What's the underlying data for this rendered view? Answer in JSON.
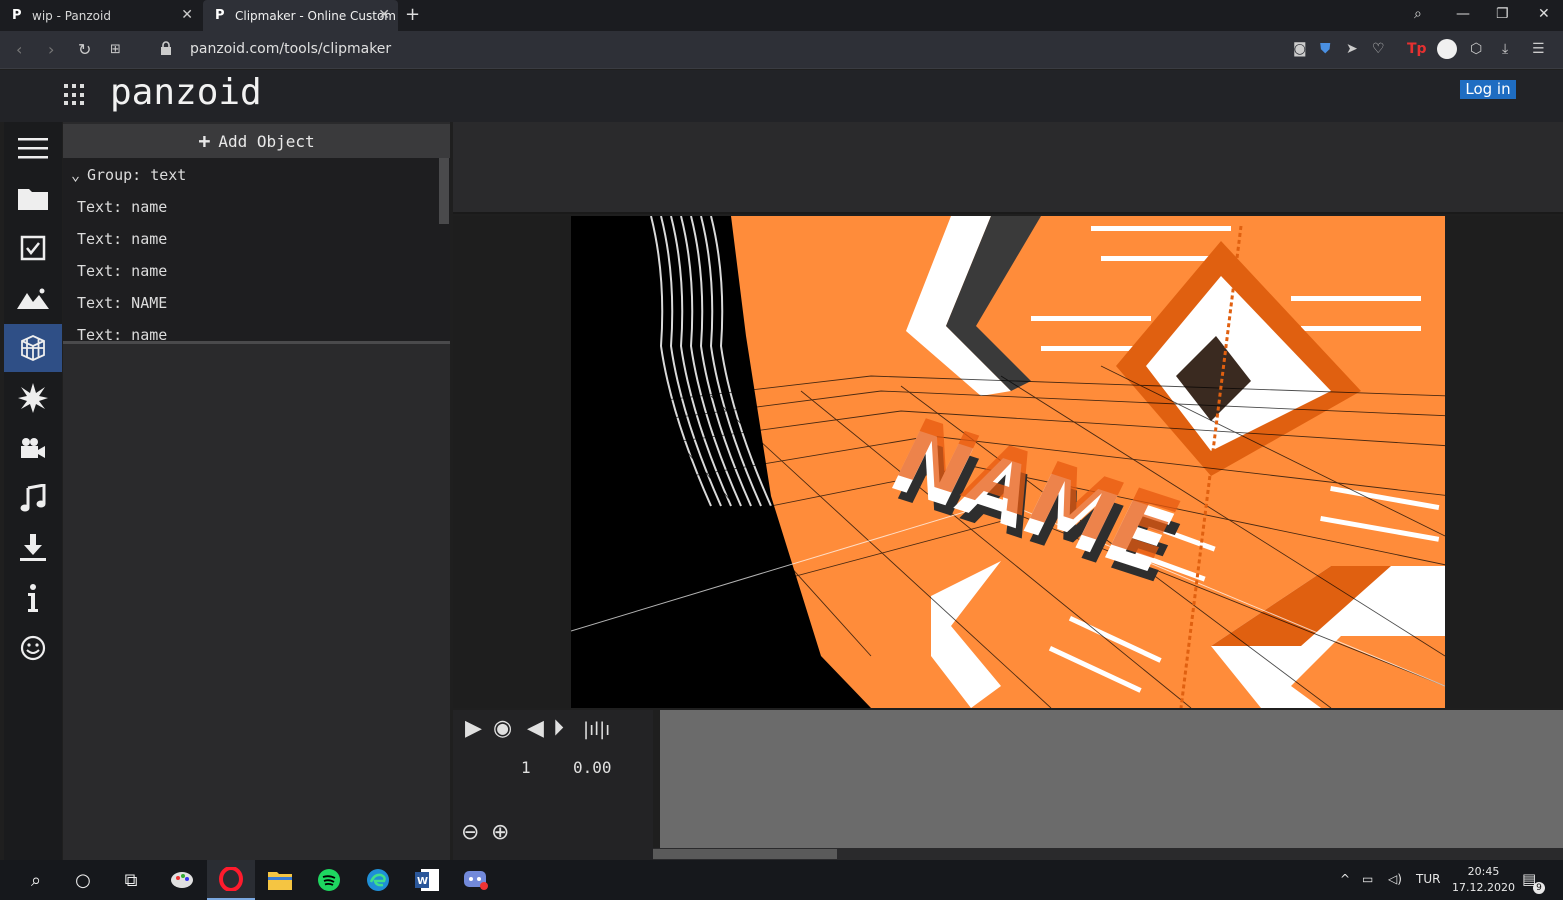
{
  "browser": {
    "tabs": [
      {
        "title": "wip - Panzoid"
      },
      {
        "title": "Clipmaker - Online Custom"
      }
    ],
    "url": "panzoid.com/tools/clipmaker"
  },
  "header": {
    "logo": "panzoid",
    "login_label": "Log in"
  },
  "object_panel": {
    "add_label": "Add Object",
    "group_label": "Group: text",
    "items": [
      "Text: name",
      "Text: name",
      "Text: name",
      "Text: NAME",
      "Text: name"
    ]
  },
  "timeline": {
    "frame": "1",
    "time": "0.00"
  },
  "taskbar": {
    "lang": "TUR",
    "time": "20:45",
    "date": "17.12.2020",
    "notif_count": "9"
  },
  "preview": {
    "text_3d": "NAME",
    "accent": "#ff8c3a",
    "accent_dark": "#e85a10"
  }
}
